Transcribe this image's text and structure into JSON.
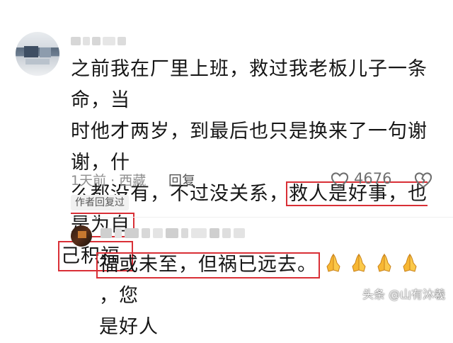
{
  "comment": {
    "text_line1": "之前我在厂里上班，救过我老板儿子一条命，当",
    "text_line2": "时他才两岁，到最后也只是换来了一句谢谢，什",
    "text_line3_plain": "么都没有，不过没关系，",
    "text_line3_highlight": "救人是好事，也是为自",
    "text_line4_highlight": "己积福",
    "time_location": "1天前 · 西藏",
    "reply_label": "回复",
    "like_count": "4676",
    "author_badge": "作者回复过"
  },
  "reply": {
    "highlight_text": "福或未至，但祸已远去。",
    "suffix_text": "，您",
    "line2_text": "是好人",
    "emoji_count": 4
  },
  "watermark": "头条 @山有沐羲",
  "colors": {
    "highlight_border": "#d92f36",
    "meta_text": "#8f8f8f",
    "body_text": "#161616"
  }
}
